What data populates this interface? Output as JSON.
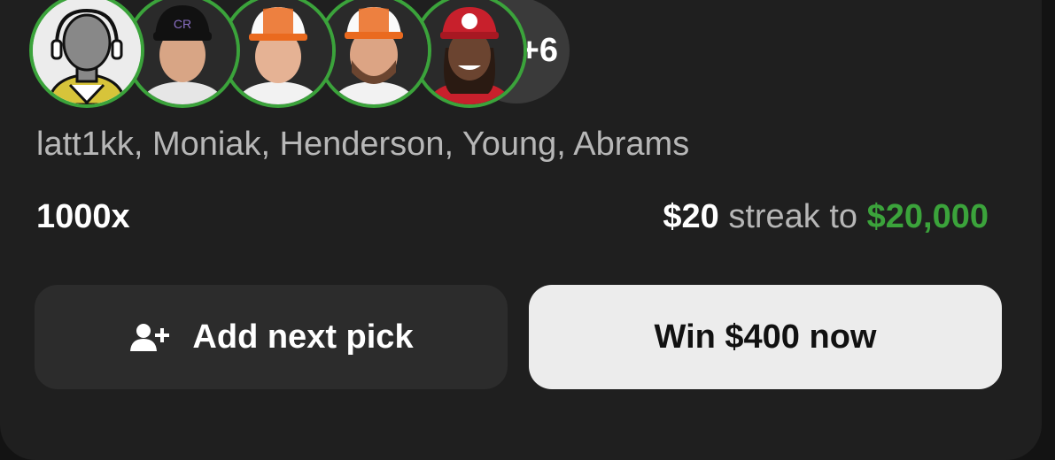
{
  "avatars": [
    {
      "name": "latt1kk",
      "icon": "user-placeholder-avatar"
    },
    {
      "name": "Moniak",
      "icon": "rockies-player-avatar"
    },
    {
      "name": "Henderson",
      "icon": "orioles-player-avatar"
    },
    {
      "name": "Young",
      "icon": "orioles-player-avatar"
    },
    {
      "name": "Abrams",
      "icon": "nationals-player-avatar"
    }
  ],
  "more_count": "+6",
  "names_line": "latt1kk, Moniak, Henderson, Young, Abrams",
  "multiplier": "1000x",
  "streak": {
    "amount": "$20",
    "middle": "streak to",
    "target": "$20,000"
  },
  "buttons": {
    "add_label": "Add next pick",
    "add_icon": "add-user-icon",
    "win_label": "Win $400 now"
  },
  "colors": {
    "accent": "#3ba33b",
    "card": "#1f1f1f",
    "win_button": "#ececec"
  }
}
